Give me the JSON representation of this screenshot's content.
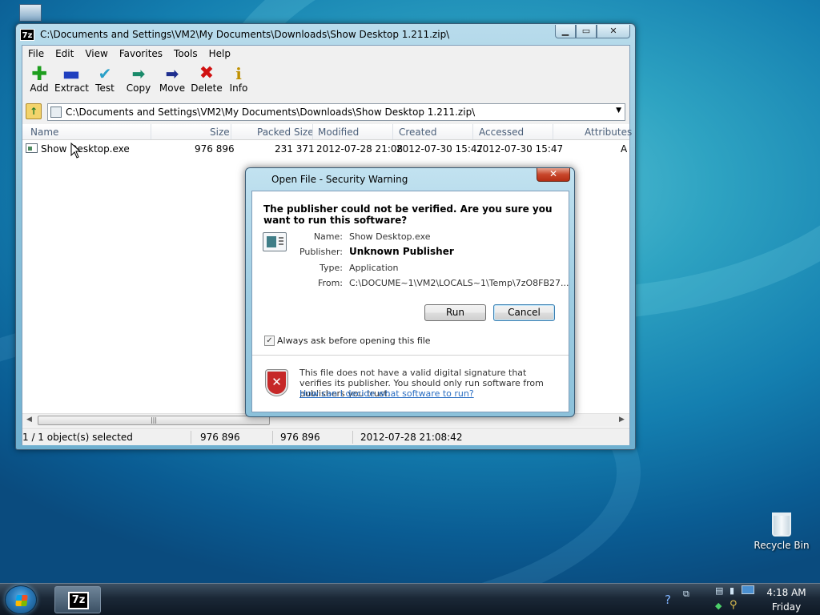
{
  "desktop": {
    "recycle_bin_label": "Recycle Bin"
  },
  "window": {
    "app_icon": "7z",
    "title": "C:\\Documents and Settings\\VM2\\My Documents\\Downloads\\Show Desktop 1.211.zip\\",
    "menu": [
      "File",
      "Edit",
      "View",
      "Favorites",
      "Tools",
      "Help"
    ],
    "toolbar": [
      {
        "label": "Add",
        "icon": "plus-icon",
        "color": "#1e9e1e"
      },
      {
        "label": "Extract",
        "icon": "minus-icon",
        "color": "#1f3fbf"
      },
      {
        "label": "Test",
        "icon": "check-icon",
        "color": "#2aa0c8"
      },
      {
        "label": "Copy",
        "icon": "arrow-icon",
        "color": "#1a8a6a"
      },
      {
        "label": "Move",
        "icon": "arrow-icon",
        "color": "#1f2f8f"
      },
      {
        "label": "Delete",
        "icon": "x-icon",
        "color": "#d01010"
      },
      {
        "label": "Info",
        "icon": "info-icon",
        "color": "#c09000"
      }
    ],
    "address": "C:\\Documents and Settings\\VM2\\My Documents\\Downloads\\Show Desktop 1.211.zip\\",
    "columns": [
      "Name",
      "Size",
      "Packed Size",
      "Modified",
      "Created",
      "Accessed",
      "Attributes"
    ],
    "rows": [
      {
        "name": "Show Desktop.exe",
        "size": "976 896",
        "packed": "231 371",
        "modified": "2012-07-28 21:08",
        "created": "2012-07-30 15:47",
        "accessed": "2012-07-30 15:47",
        "attributes": "A"
      }
    ],
    "status": {
      "selected": "1 / 1 object(s) selected",
      "size": "976 896",
      "packed": "976 896",
      "date": "2012-07-28 21:08:42"
    }
  },
  "dialog": {
    "title": "Open File - Security Warning",
    "question": "The publisher could not be verified.  Are you sure you want to run this software?",
    "fields": {
      "name_label": "Name:",
      "name_value": "Show Desktop.exe",
      "publisher_label": "Publisher:",
      "publisher_value": "Unknown Publisher",
      "type_label": "Type:",
      "type_value": "Application",
      "from_label": "From:",
      "from_value": "C:\\DOCUME~1\\VM2\\LOCALS~1\\Temp\\7zO8FB27..."
    },
    "run_label": "Run",
    "cancel_label": "Cancel",
    "checkbox_label": "Always ask before opening this file",
    "checkbox_checked": true,
    "warning_text": "This file does not have a valid digital signature that verifies its publisher.  You should only run software from publishers you trust.",
    "warning_link": "How can I decide what software to run?"
  },
  "taskbar": {
    "task_label": "7z",
    "clock_time": "4:18 AM",
    "clock_day": "Friday"
  }
}
